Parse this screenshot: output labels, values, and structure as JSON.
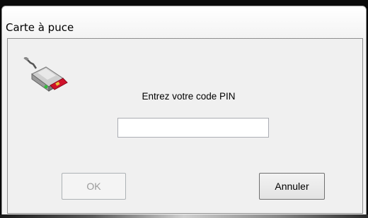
{
  "window": {
    "title": "Carte à puce"
  },
  "dialog": {
    "icon": "smart-card-reader-icon",
    "prompt": "Entrez votre code PIN",
    "pin_value": "",
    "ok_label": "OK",
    "cancel_label": "Annuler"
  }
}
